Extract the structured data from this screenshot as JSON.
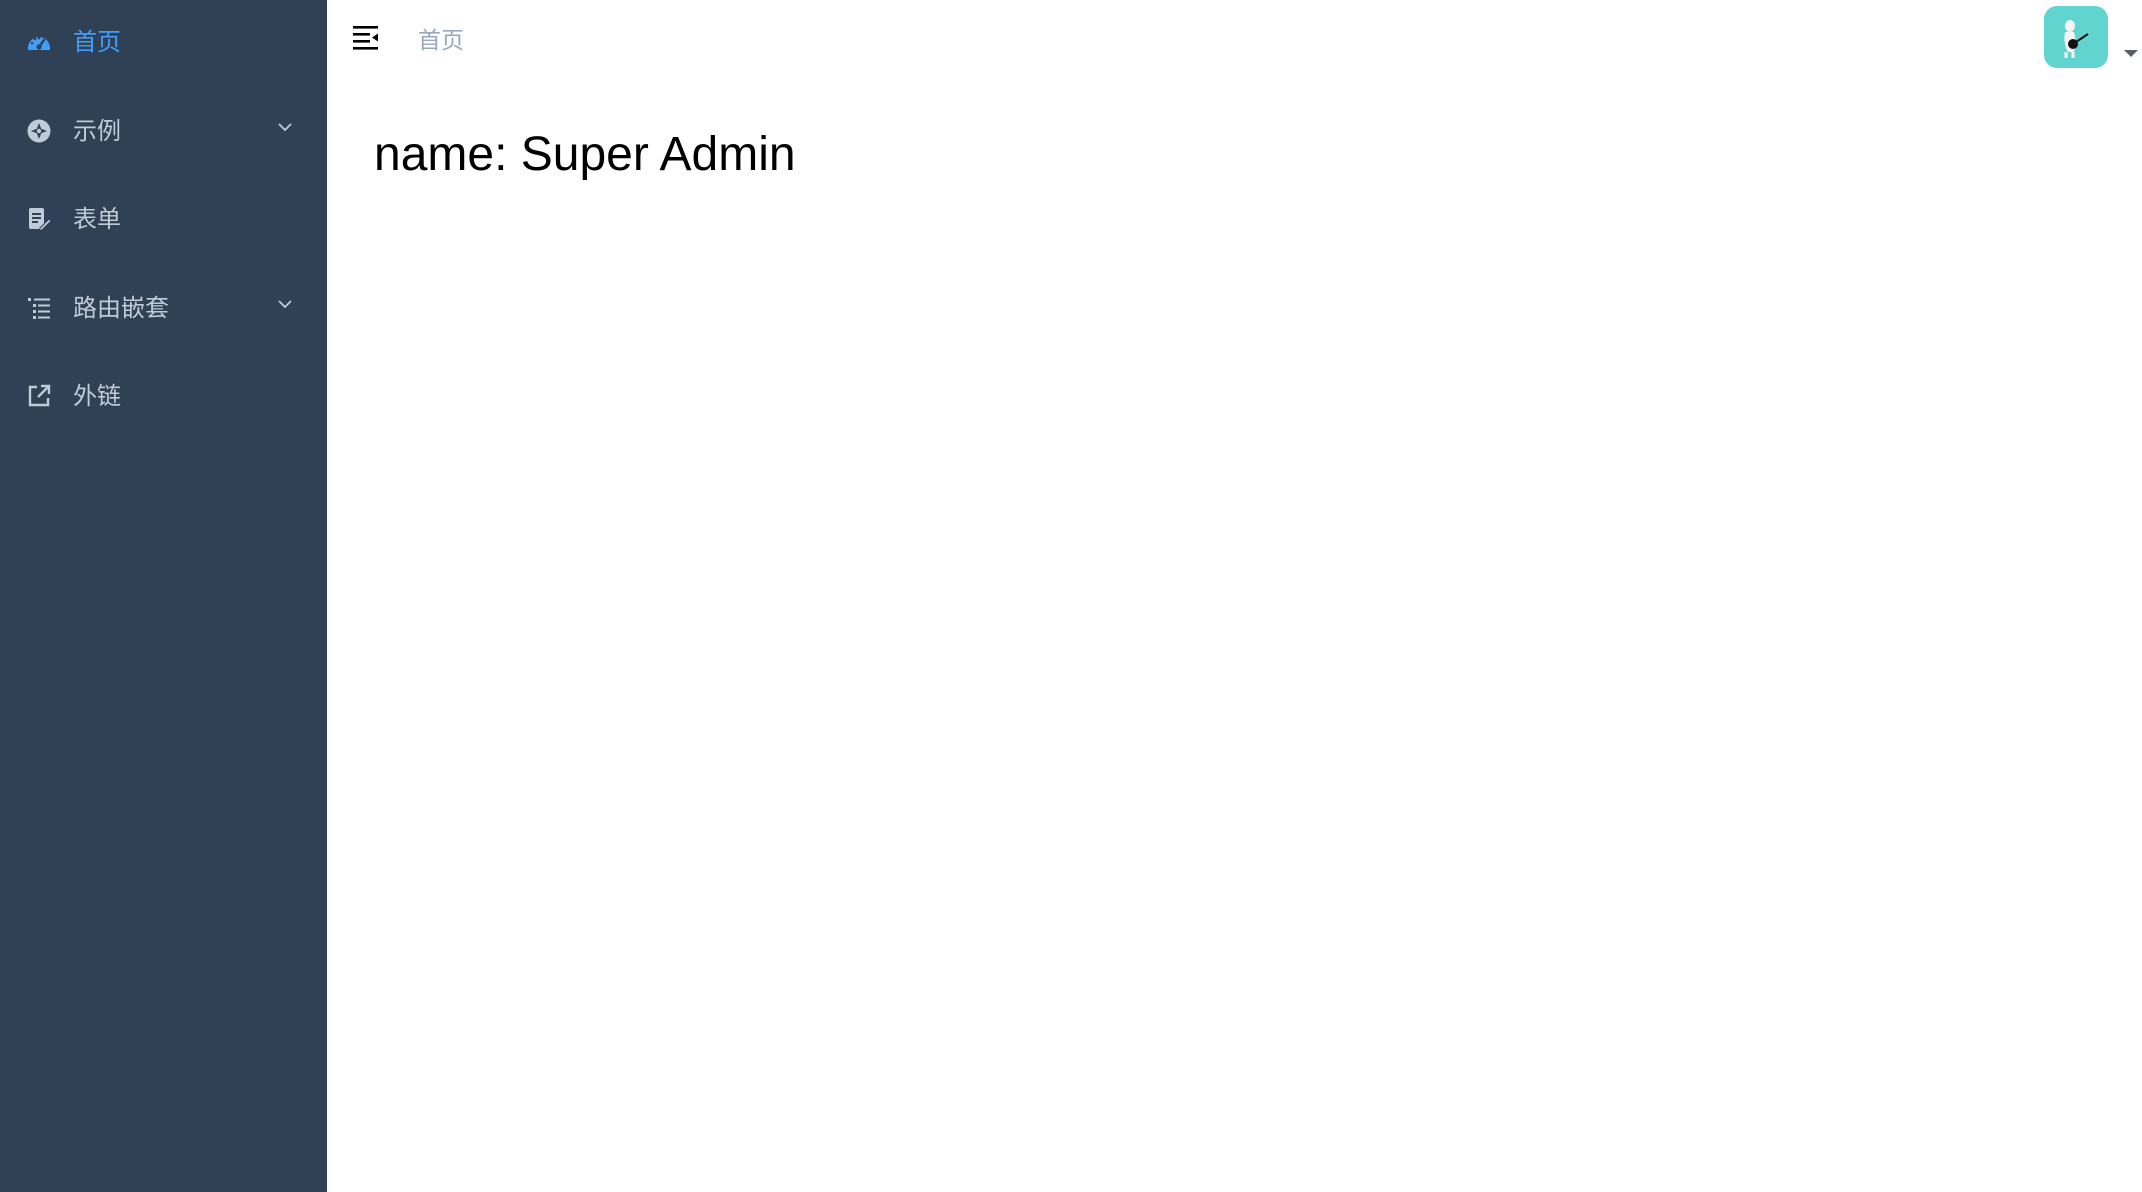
{
  "sidebar": {
    "items": [
      {
        "label": "首页",
        "icon": "dashboard-icon",
        "active": true,
        "has_children": false
      },
      {
        "label": "示例",
        "icon": "example-icon",
        "active": false,
        "has_children": true
      },
      {
        "label": "表单",
        "icon": "form-icon",
        "active": false,
        "has_children": false
      },
      {
        "label": "路由嵌套",
        "icon": "nested-icon",
        "active": false,
        "has_children": true
      },
      {
        "label": "外链",
        "icon": "external-link-icon",
        "active": false,
        "has_children": false
      }
    ]
  },
  "navbar": {
    "breadcrumb": "首页",
    "hamburger_icon": "hamburger-icon",
    "avatar_icon": "avatar-icon",
    "dropdown_icon": "caret-down-icon"
  },
  "main": {
    "dashboard_text": "name: Super Admin"
  },
  "colors": {
    "sidebar_bg": "#304156",
    "sidebar_text": "#bfcbd9",
    "active": "#409eff",
    "breadcrumb": "#97a8be",
    "avatar_bg": "#62d4d0"
  }
}
